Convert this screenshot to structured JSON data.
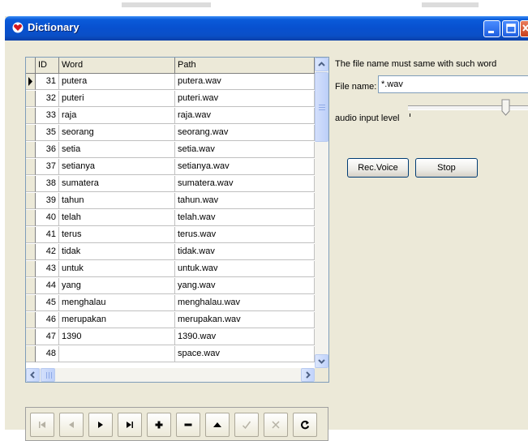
{
  "window": {
    "title": "Dictionary"
  },
  "grid": {
    "columns": [
      {
        "label": "ID"
      },
      {
        "label": "Word"
      },
      {
        "label": "Path"
      }
    ],
    "rows": [
      {
        "id": "31",
        "word": "putera",
        "path": "putera.wav"
      },
      {
        "id": "32",
        "word": "puteri",
        "path": "puteri.wav"
      },
      {
        "id": "33",
        "word": "raja",
        "path": "raja.wav"
      },
      {
        "id": "35",
        "word": "seorang",
        "path": "seorang.wav"
      },
      {
        "id": "36",
        "word": "setia",
        "path": "setia.wav"
      },
      {
        "id": "37",
        "word": "setianya",
        "path": "setianya.wav"
      },
      {
        "id": "38",
        "word": "sumatera",
        "path": "sumatera.wav"
      },
      {
        "id": "39",
        "word": "tahun",
        "path": "tahun.wav"
      },
      {
        "id": "40",
        "word": "telah",
        "path": "telah.wav"
      },
      {
        "id": "41",
        "word": "terus",
        "path": "terus.wav"
      },
      {
        "id": "42",
        "word": "tidak",
        "path": "tidak.wav"
      },
      {
        "id": "43",
        "word": "untuk",
        "path": "untuk.wav"
      },
      {
        "id": "44",
        "word": "yang",
        "path": "yang.wav"
      },
      {
        "id": "45",
        "word": "menghalau",
        "path": "menghalau.wav"
      },
      {
        "id": "46",
        "word": "merupakan",
        "path": "merupakan.wav"
      },
      {
        "id": "47",
        "word": "1390",
        "path": "1390.wav"
      },
      {
        "id": "48",
        "word": "",
        "path": "space.wav"
      }
    ],
    "current_row": 0
  },
  "navigator": {
    "buttons": [
      {
        "name": "first-record-icon",
        "enabled": false
      },
      {
        "name": "prior-record-icon",
        "enabled": false
      },
      {
        "name": "next-record-icon",
        "enabled": true
      },
      {
        "name": "last-record-icon",
        "enabled": true
      },
      {
        "name": "insert-record-icon",
        "enabled": true
      },
      {
        "name": "delete-record-icon",
        "enabled": true
      },
      {
        "name": "edit-record-icon",
        "enabled": true
      },
      {
        "name": "post-edit-icon",
        "enabled": false
      },
      {
        "name": "cancel-edit-icon",
        "enabled": false
      },
      {
        "name": "refresh-data-icon",
        "enabled": true
      }
    ]
  },
  "panel": {
    "info_text": "The file name must same with such word",
    "file_label": "File name:",
    "file_value": "*.wav",
    "audio_label": "audio input level",
    "audio_level_fraction": 0.8,
    "rec_button": "Rec.Voice",
    "stop_button": "Stop"
  },
  "colors": {
    "titlebar": "#0a5bd9",
    "face": "#ece9d8",
    "close_button": "#e06c4b"
  }
}
